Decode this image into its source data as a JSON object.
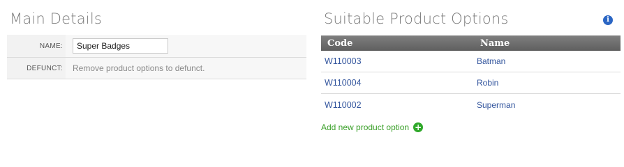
{
  "main_details": {
    "title": "Main Details",
    "fields": {
      "name_label": "NAME:",
      "name_value": "Super Badges",
      "defunct_label": "DEFUNCT:",
      "defunct_note": "Remove product options to defunct."
    }
  },
  "product_options": {
    "title": "Suitable Product Options",
    "info_icon": "i",
    "columns": {
      "code": "Code",
      "name": "Name"
    },
    "rows": [
      {
        "code": "W110003",
        "name": "Batman"
      },
      {
        "code": "W110004",
        "name": "Robin"
      },
      {
        "code": "W110002",
        "name": "Superman"
      }
    ],
    "add_label": "Add new product option",
    "add_icon": "+"
  },
  "colors": {
    "link": "#34569e",
    "add_link": "#3ba02a",
    "header_bg": "#6f6f6f",
    "info_icon": "#2b66c4"
  }
}
